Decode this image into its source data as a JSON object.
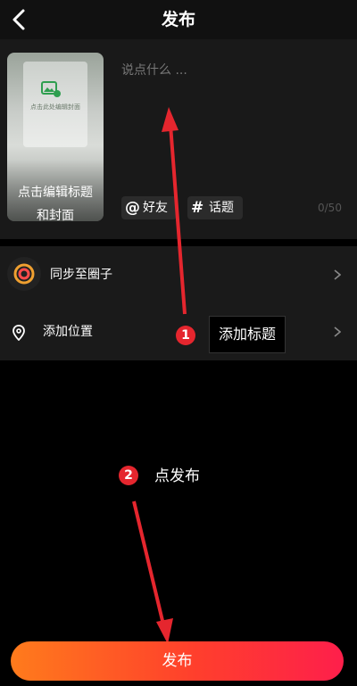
{
  "header": {
    "title": "发布",
    "back_icon": "chevron-left-icon"
  },
  "composer": {
    "cover_label": "点击编辑标题\n和封面",
    "cover_small_text": "点击此处编辑封面",
    "placeholder": "说点什么 ...",
    "mention_symbol": "@",
    "mention_label": "好友",
    "topic_symbol": "#",
    "topic_label": "话题",
    "counter": "0/50"
  },
  "rows": {
    "circle_label": "同步至圈子",
    "location_label": "添加位置"
  },
  "annotations": {
    "badge_1": "1",
    "tip_1": "添加标题",
    "badge_2": "2",
    "tip_2": "点发布",
    "color": "#e5262e"
  },
  "publish": {
    "label": "发布"
  },
  "colors": {
    "publish_start": "#ff7b1c",
    "publish_end": "#fe1f4b",
    "accent": "#e5262e"
  }
}
